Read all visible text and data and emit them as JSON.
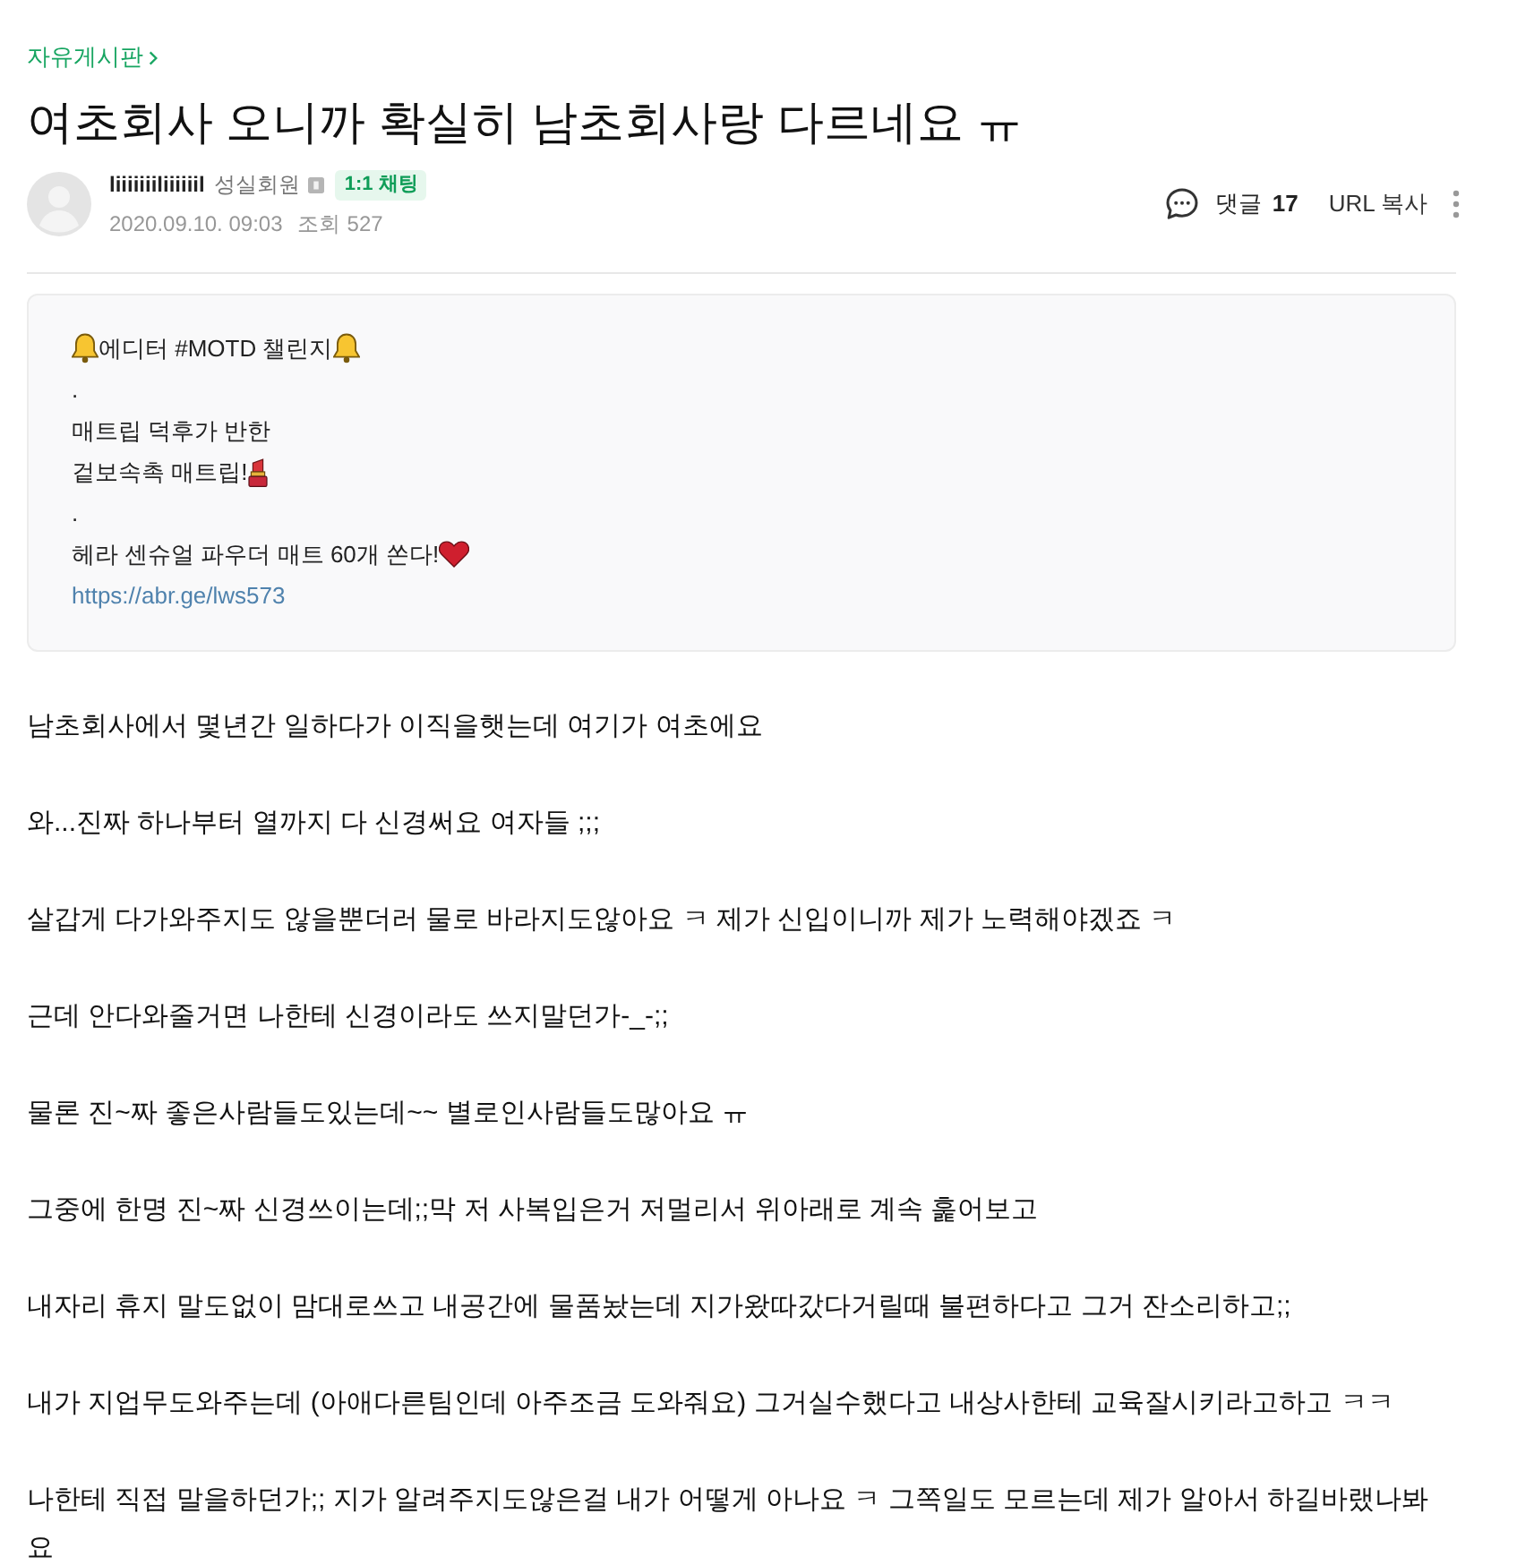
{
  "breadcrumb": {
    "label": "자유게시판"
  },
  "title": "여초회사 오니까 확실히 남초회사랑 다르네요 ㅠ",
  "author": {
    "name": "liiiiiiiliiiiiil",
    "rank": "성실회원",
    "chat_button": "1:1 채팅"
  },
  "meta": {
    "date": "2020.09.10. 09:03",
    "views_label": "조회",
    "views": "527"
  },
  "actions": {
    "comments_label": "댓글",
    "comments_count": "17",
    "url_copy": "URL 복사"
  },
  "notice": {
    "lines": [
      {
        "parts": [
          {
            "kind": "bell"
          },
          {
            "kind": "text",
            "text": "에디터 #MOTD 챌린지"
          },
          {
            "kind": "bell"
          }
        ]
      },
      {
        "parts": [
          {
            "kind": "text",
            "text": "."
          }
        ]
      },
      {
        "parts": [
          {
            "kind": "text",
            "text": "매트립 덕후가 반한"
          }
        ]
      },
      {
        "parts": [
          {
            "kind": "text",
            "text": "겉보속촉 매트립!"
          },
          {
            "kind": "lipstick"
          }
        ]
      },
      {
        "parts": [
          {
            "kind": "text",
            "text": "."
          }
        ]
      },
      {
        "parts": [
          {
            "kind": "text",
            "text": "헤라 센슈얼 파우더 매트 60개 쏜다!"
          },
          {
            "kind": "heart"
          }
        ]
      },
      {
        "parts": [
          {
            "kind": "link",
            "text": "https://abr.ge/lws573"
          }
        ]
      }
    ]
  },
  "body": [
    "남초회사에서 몇년간 일하다가 이직을햇는데 여기가 여초에요",
    "와...진짜 하나부터 열까지 다 신경써요 여자들 ;;;",
    "살갑게 다가와주지도 않을뿐더러 물로 바라지도않아요 ㅋ 제가 신입이니까 제가 노력해야겠죠 ㅋ",
    "근데 안다와줄거면 나한테 신경이라도 쓰지말던가-_-;;",
    "물론 진~짜 좋은사람들도있는데~~ 별로인사람들도많아요 ㅠ",
    "그중에 한명 진~짜 신경쓰이는데;;막 저 사복입은거 저멀리서 위아래로 계속 훑어보고",
    "내자리 휴지 말도없이 맘대로쓰고 내공간에 물품놨는데 지가왔따갔다거릴때 불편하다고 그거 잔소리하고;;",
    "내가 지업무도와주는데 (아애다른팀인데 아주조금 도와줘요) 그거실수했다고 내상사한테 교육잘시키라고하고 ㅋㅋ",
    "나한테 직접 말을하던가;; 지가 알려주지도않은걸 내가 어떻게 아나요 ㅋ 그쪽일도 모르는데 제가 알아서 하길바랬나봐요"
  ]
}
